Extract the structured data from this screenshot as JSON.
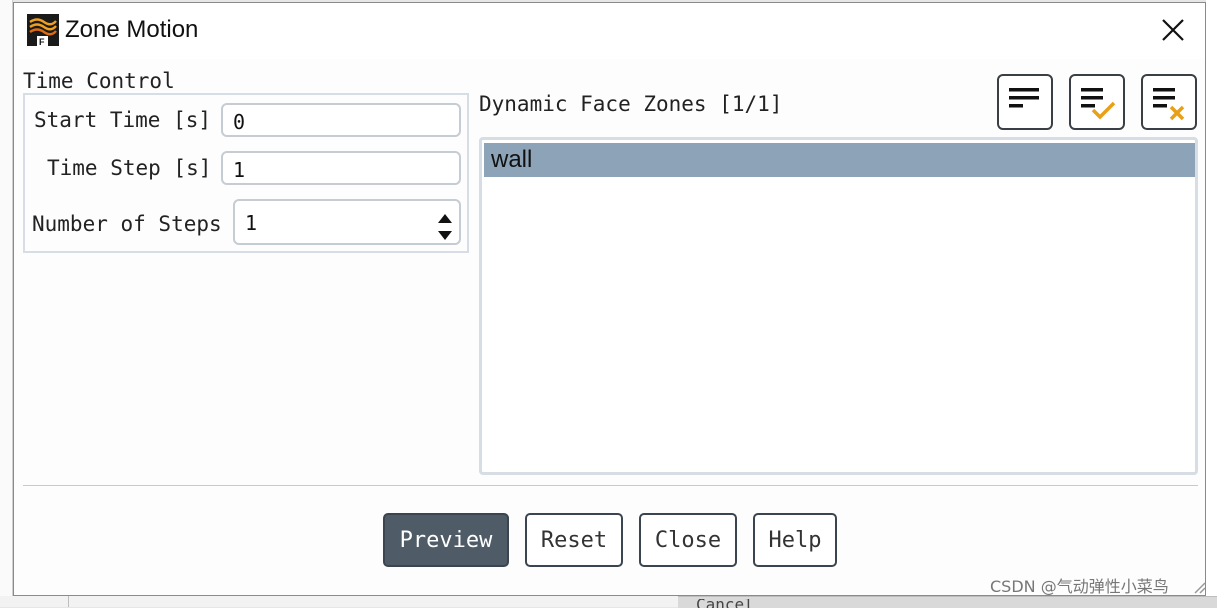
{
  "window": {
    "title": "Zone Motion"
  },
  "colors": {
    "accent": "#4f5b66",
    "selection": "#8ca3b8",
    "icon_check": "#e8a016",
    "icon_cross": "#e8a016"
  },
  "time_control": {
    "group_label": "Time Control",
    "start_time": {
      "label": "Start Time [s]",
      "value": "0"
    },
    "time_step": {
      "label": "Time Step [s]",
      "value": "1"
    },
    "number_of_steps": {
      "label": "Number of Steps",
      "value": "1"
    }
  },
  "dynamic_face_zones": {
    "label": "Dynamic Face Zones [1/1]",
    "items": [
      {
        "label": "wall",
        "selected": true
      }
    ],
    "toolbar": [
      {
        "name": "list-view",
        "icon": "lines-icon"
      },
      {
        "name": "select-all",
        "icon": "lines-check-icon"
      },
      {
        "name": "deselect-all",
        "icon": "lines-cross-icon"
      }
    ]
  },
  "buttons": {
    "preview": "Preview",
    "reset": "Reset",
    "close": "Close",
    "help": "Help"
  },
  "background": {
    "bottom_text": "Cancel"
  },
  "watermark": "CSDN @气动弹性小菜鸟"
}
